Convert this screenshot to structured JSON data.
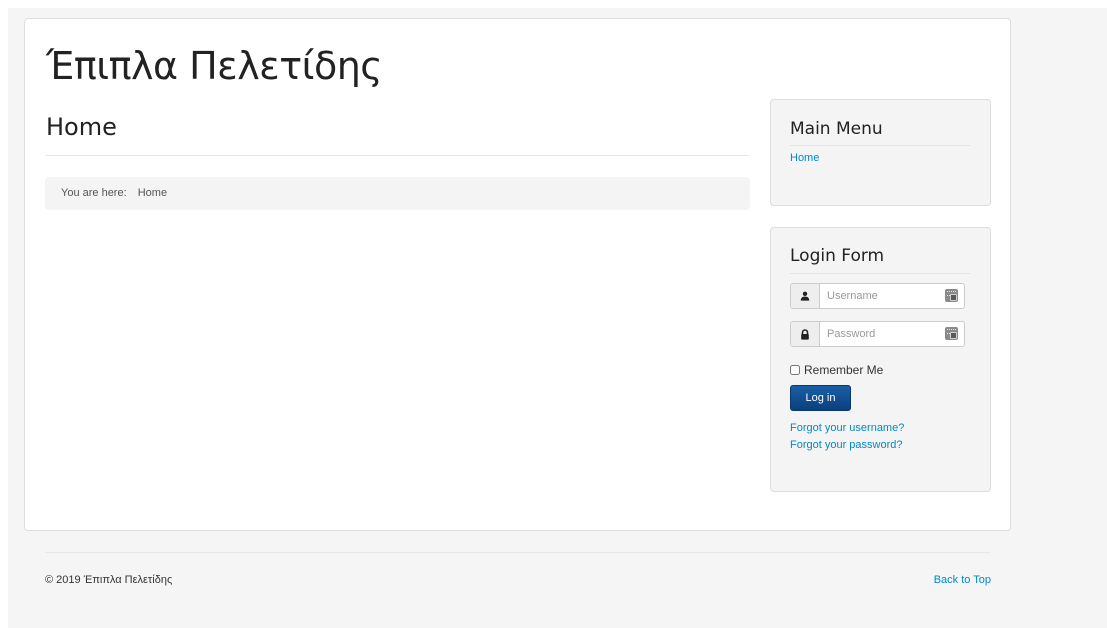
{
  "site": {
    "title": "Έπιπλα Πελετίδης"
  },
  "page": {
    "heading": "Home"
  },
  "breadcrumb": {
    "label": "You are here:",
    "items": [
      "Home"
    ]
  },
  "main_menu": {
    "title": "Main Menu",
    "items": [
      {
        "label": "Home"
      }
    ]
  },
  "login_form": {
    "title": "Login Form",
    "username_placeholder": "Username",
    "password_placeholder": "Password",
    "remember_label": "Remember Me",
    "remember_checked": false,
    "submit_label": "Log in",
    "forgot_username": "Forgot your username?",
    "forgot_password": "Forgot your password?"
  },
  "footer": {
    "copyright": "© 2019 Έπιπλα Πελετίδης",
    "back_to_top": "Back to Top"
  },
  "colors": {
    "link": "#0088cc",
    "button": "#0b3f7e",
    "panel": "#f4f4f4"
  },
  "icons": {
    "user_addon": "user-icon",
    "password_addon": "lock-icon",
    "keypad": "keypad-icon"
  }
}
